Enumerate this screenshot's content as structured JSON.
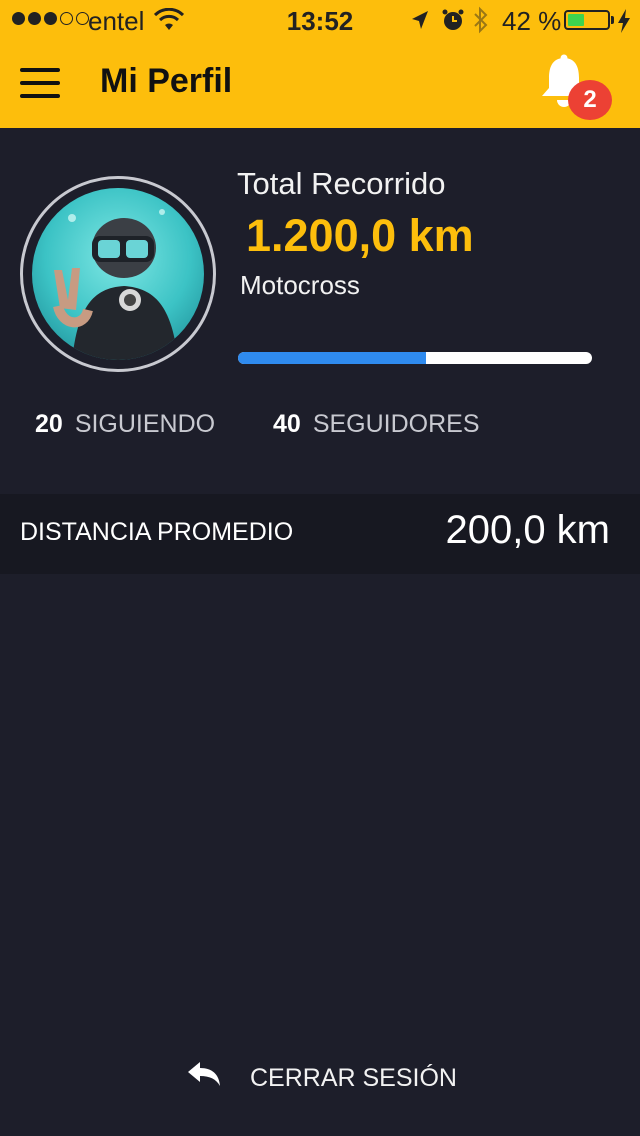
{
  "status_bar": {
    "carrier": "entel",
    "time": "13:52",
    "battery_percent": "42 %",
    "battery_level": 0.42,
    "signal_bars_filled": 3,
    "signal_bars_total": 5
  },
  "header": {
    "title": "Mi Perfil",
    "notification_count": "2",
    "background_color": "#fdbe0c"
  },
  "profile": {
    "total_label": "Total Recorrido",
    "total_value": "1.200,0 km",
    "category": "Motocross",
    "progress": 0.53,
    "following_count": "20",
    "following_label": "SIGUIENDO",
    "followers_count": "40",
    "followers_label": "SEGUIDORES"
  },
  "stats": {
    "average_distance_label": "DISTANCIA PROMEDIO",
    "average_distance_value": "200,0 km"
  },
  "footer": {
    "logout_label": "CERRAR SESIÓN",
    "logout_icon": "reply-arrow-icon"
  },
  "colors": {
    "accent": "#fdbe0c",
    "background": "#1d1e2a",
    "progress": "#2f8bef",
    "badge": "#ec4134"
  }
}
